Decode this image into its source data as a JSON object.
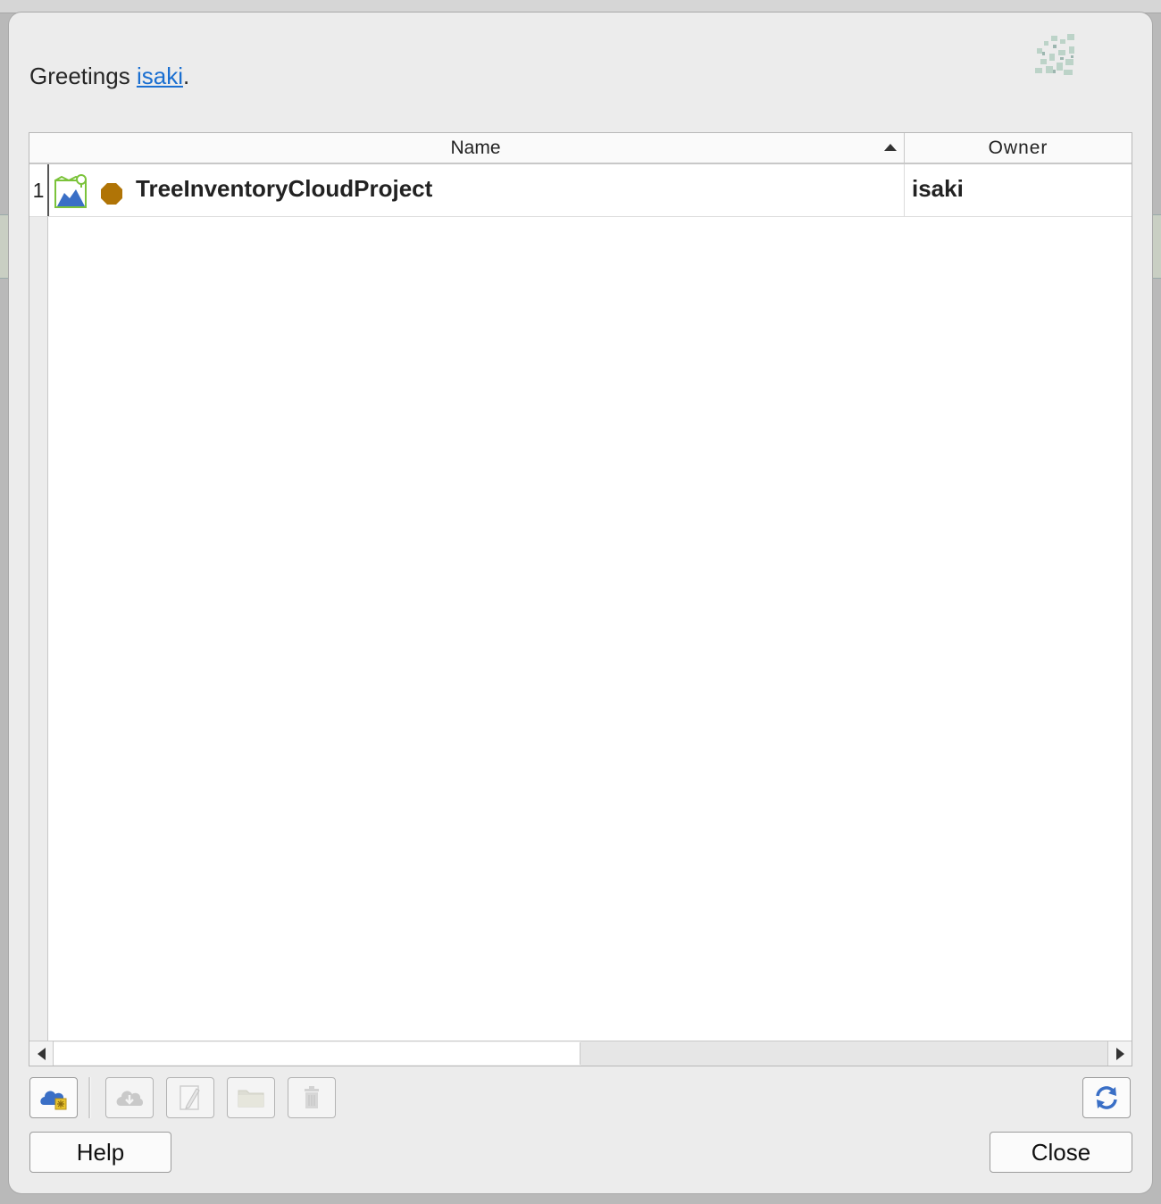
{
  "greeting": {
    "prefix": "Greetings ",
    "username": "isaki",
    "suffix": "."
  },
  "table": {
    "columns": [
      "Name",
      "Owner"
    ],
    "sort": "ascending",
    "rows": [
      {
        "index": "1",
        "name": "TreeInventoryCloudProject",
        "owner": "isaki",
        "icon": "qgis-project-icon",
        "status": "status-dot-icon"
      }
    ]
  },
  "toolbar": {
    "buttons": [
      "create-cloud-project-icon",
      "download-cloud-icon",
      "edit-icon",
      "open-folder-icon",
      "delete-icon",
      "refresh-icon"
    ]
  },
  "buttons": {
    "help": "Help",
    "close": "Close"
  },
  "colors": {
    "link": "#1a6fd1",
    "status": "#b07406",
    "cloud": "#3a6fc6"
  }
}
